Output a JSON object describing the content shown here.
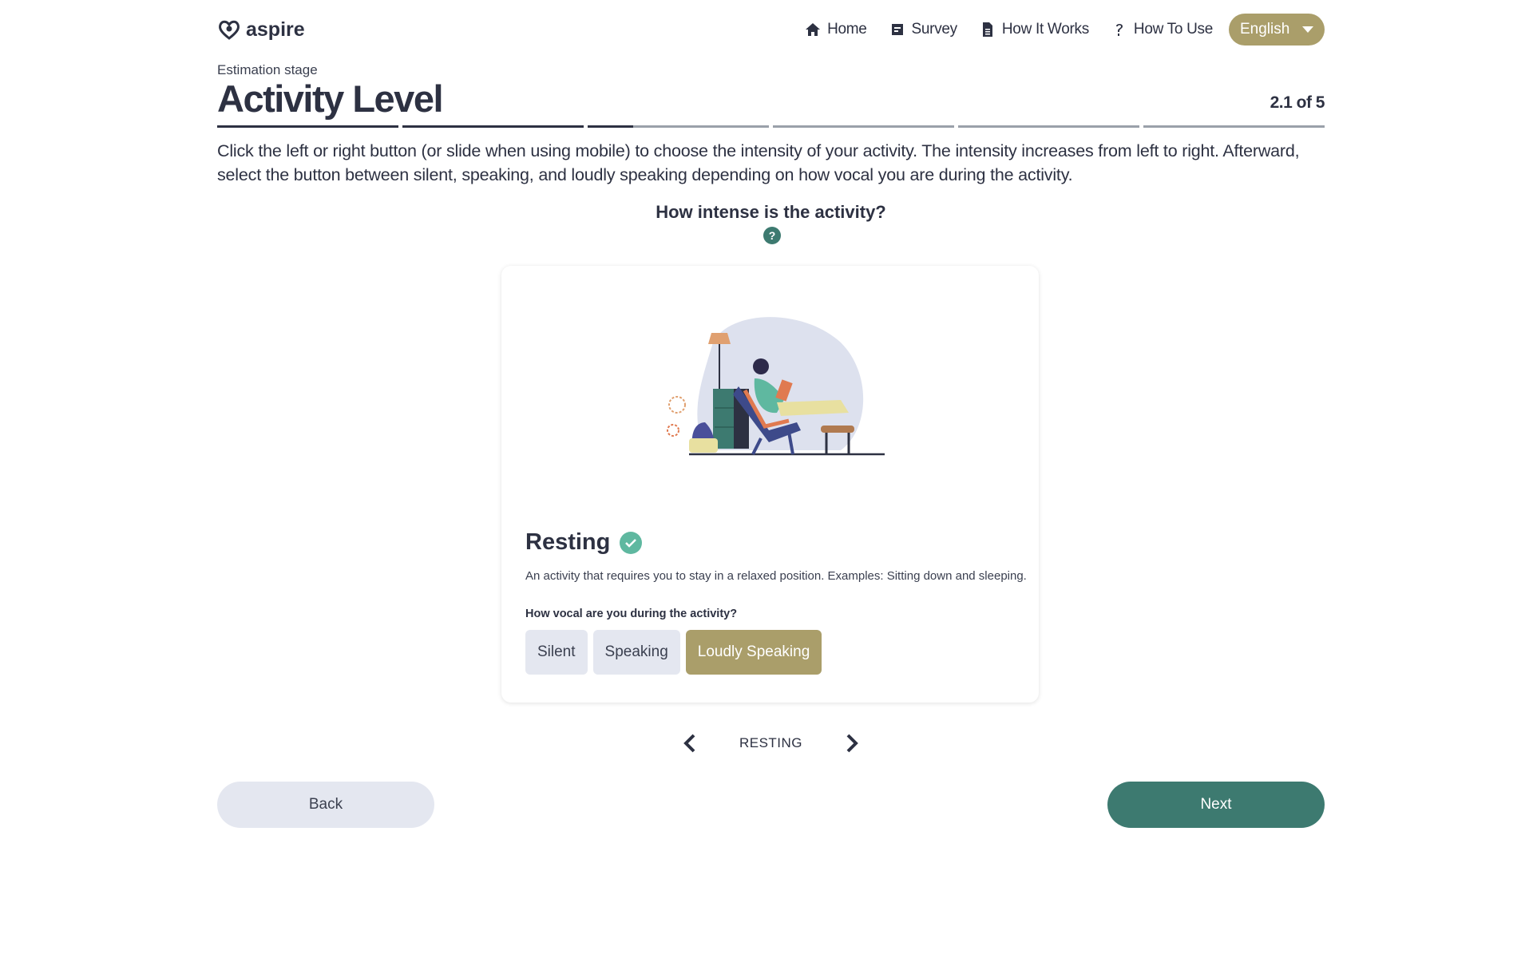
{
  "brand": {
    "name": "aspire"
  },
  "nav": {
    "items": [
      {
        "label": "Home",
        "icon": "home-icon"
      },
      {
        "label": "Survey",
        "icon": "survey-icon"
      },
      {
        "label": "How It Works",
        "icon": "document-icon"
      },
      {
        "label": "How To Use",
        "icon": "question-icon"
      }
    ],
    "language": "English"
  },
  "header": {
    "stage": "Estimation stage",
    "title": "Activity Level",
    "step": "2.1 of 5",
    "progress": [
      1.0,
      1.0,
      0.25,
      0,
      0,
      0
    ]
  },
  "instructions": "Click the left or right button (or slide when using mobile) to choose the intensity of your activity. The intensity increases from left to right. Afterward, select the button between silent, speaking, and loudly speaking depending on how vocal you are during the activity.",
  "question": {
    "text": "How intense is the activity?",
    "help": "?"
  },
  "card": {
    "activity": "Resting",
    "description": "An activity that requires you to stay in a relaxed position. Examples: Sitting down and sleeping.",
    "vocal_question": "How vocal are you during the activity?",
    "vocal_options": [
      "Silent",
      "Speaking",
      "Loudly Speaking"
    ],
    "vocal_selected": "Loudly Speaking"
  },
  "carousel": {
    "label": "RESTING"
  },
  "buttons": {
    "back": "Back",
    "next": "Next"
  },
  "colors": {
    "primary": "#3d7a70",
    "accent": "#aa9e6a",
    "text": "#2d3142",
    "muted_bg": "#e4e7f0"
  }
}
